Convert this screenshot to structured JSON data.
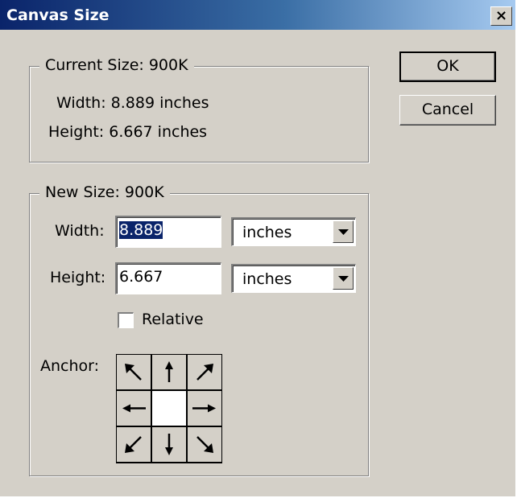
{
  "window": {
    "title": "Canvas Size",
    "close_glyph": "×"
  },
  "current_size": {
    "legend": "Current Size:  900K",
    "width_text": "Width:  8.889 inches",
    "height_text": "Height:  6.667 inches"
  },
  "new_size": {
    "legend": "New Size:  900K",
    "width_label": "Width:",
    "width_value": "8.889",
    "width_unit": "inches",
    "height_label": "Height:",
    "height_value": "6.667",
    "height_unit": "inches",
    "relative_label": "Relative",
    "relative_checked": false,
    "anchor_label": "Anchor:",
    "anchor_cells": [
      {
        "name": "anchor-top-left",
        "icon": "arrow-nw-icon"
      },
      {
        "name": "anchor-top-center",
        "icon": "arrow-n-icon"
      },
      {
        "name": "anchor-top-right",
        "icon": "arrow-ne-icon"
      },
      {
        "name": "anchor-middle-left",
        "icon": "arrow-w-icon"
      },
      {
        "name": "anchor-center",
        "icon": ""
      },
      {
        "name": "anchor-middle-right",
        "icon": "arrow-e-icon"
      },
      {
        "name": "anchor-bottom-left",
        "icon": "arrow-sw-icon"
      },
      {
        "name": "anchor-bottom-center",
        "icon": "arrow-s-icon"
      },
      {
        "name": "anchor-bottom-right",
        "icon": "arrow-se-icon"
      }
    ],
    "anchor_selected": "anchor-center"
  },
  "buttons": {
    "ok": "OK",
    "cancel": "Cancel"
  },
  "colors": {
    "title_gradient_start": "#0a246a",
    "title_gradient_end": "#a6caf0",
    "face": "#d4d0c8",
    "selection": "#0a246a"
  }
}
